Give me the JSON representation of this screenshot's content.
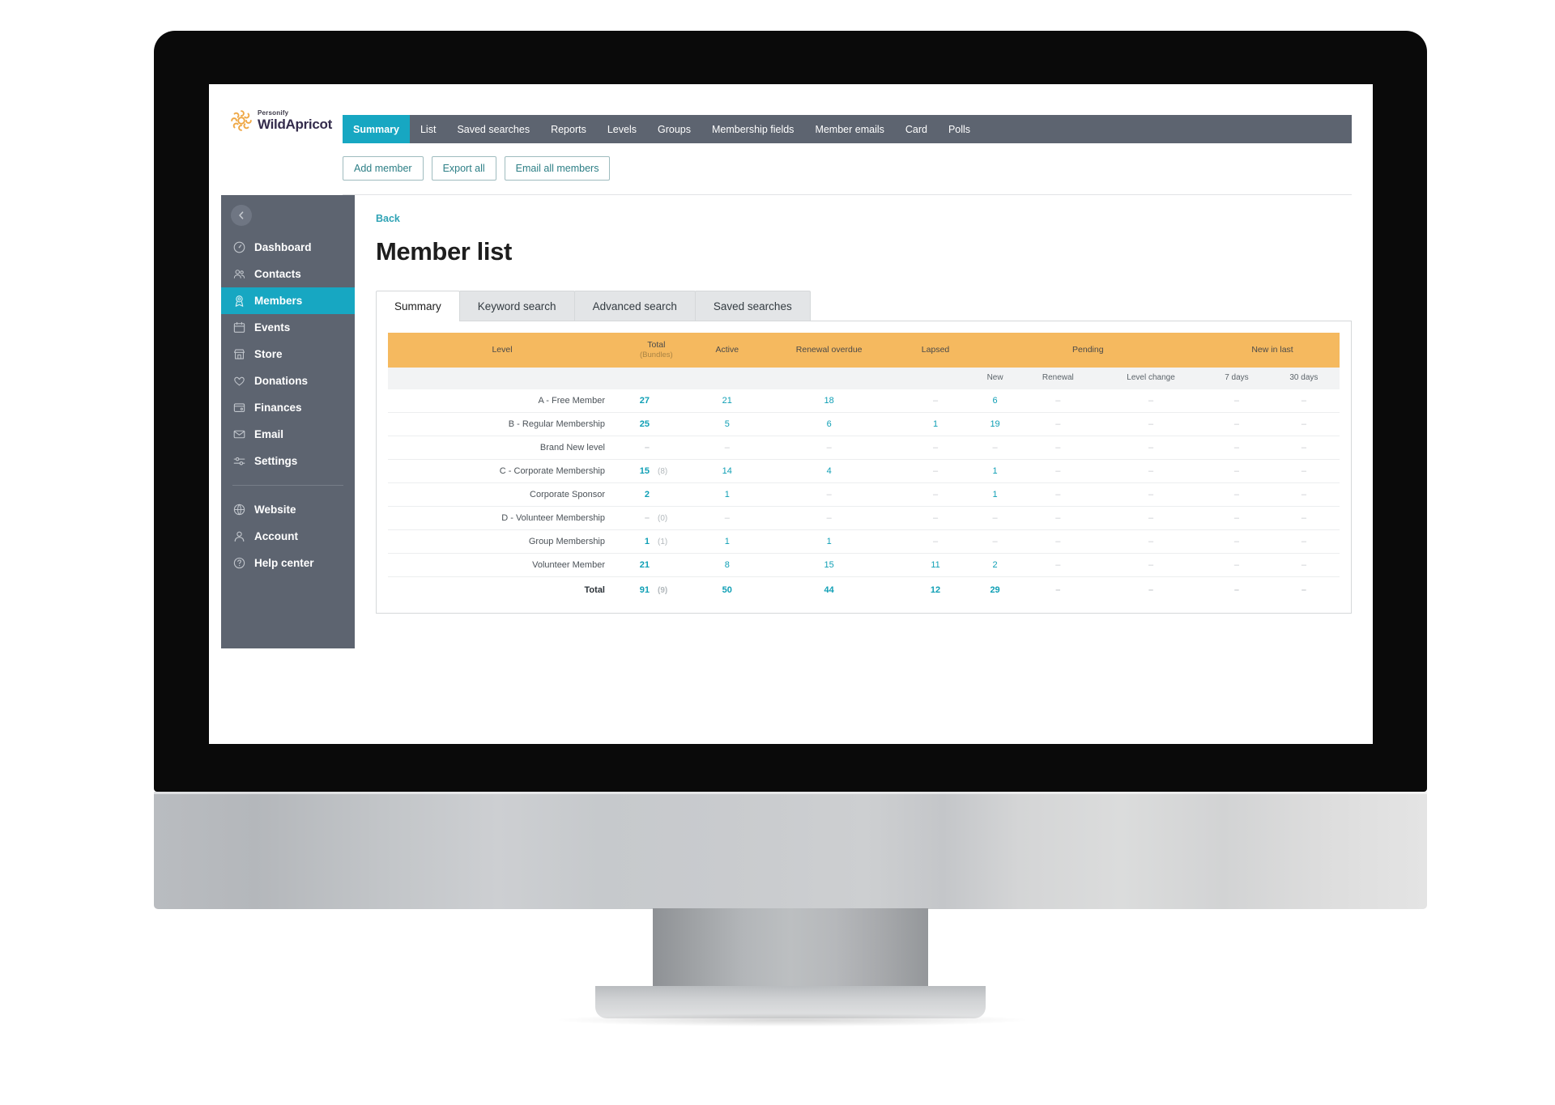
{
  "brand": {
    "parent": "Personify",
    "name": "WildApricot",
    "mark_icon": "sunburst-icon",
    "mark_color": "#efa846",
    "name_color": "#342c4c"
  },
  "top_nav": {
    "items": [
      {
        "label": "Summary",
        "active": true
      },
      {
        "label": "List",
        "active": false
      },
      {
        "label": "Saved searches",
        "active": false
      },
      {
        "label": "Reports",
        "active": false
      },
      {
        "label": "Levels",
        "active": false
      },
      {
        "label": "Groups",
        "active": false
      },
      {
        "label": "Membership fields",
        "active": false
      },
      {
        "label": "Member emails",
        "active": false
      },
      {
        "label": "Card",
        "active": false
      },
      {
        "label": "Polls",
        "active": false
      }
    ],
    "active_color": "#17a7c2",
    "bar_color": "#5d6470"
  },
  "action_bar": {
    "buttons": [
      {
        "label": "Add member",
        "name": "add-member-button"
      },
      {
        "label": "Export all",
        "name": "export-all-button"
      },
      {
        "label": "Email all members",
        "name": "email-all-members-button"
      }
    ]
  },
  "sidebar": {
    "collapse_icon": "chevron-left-icon",
    "items": [
      {
        "label": "Dashboard",
        "icon": "speedometer-icon",
        "active": false
      },
      {
        "label": "Contacts",
        "icon": "people-icon",
        "active": false
      },
      {
        "label": "Members",
        "icon": "member-badge-icon",
        "active": true
      },
      {
        "label": "Events",
        "icon": "calendar-icon",
        "active": false
      },
      {
        "label": "Store",
        "icon": "storefront-icon",
        "active": false
      },
      {
        "label": "Donations",
        "icon": "heart-icon",
        "active": false
      },
      {
        "label": "Finances",
        "icon": "wallet-icon",
        "active": false
      },
      {
        "label": "Email",
        "icon": "envelope-icon",
        "active": false
      },
      {
        "label": "Settings",
        "icon": "sliders-icon",
        "active": false
      }
    ],
    "items_secondary": [
      {
        "label": "Website",
        "icon": "globe-icon",
        "active": false
      },
      {
        "label": "Account",
        "icon": "person-icon",
        "active": false
      },
      {
        "label": "Help center",
        "icon": "question-circle-icon",
        "active": false
      }
    ]
  },
  "main": {
    "back_label": "Back",
    "title": "Member list",
    "tabs": [
      {
        "label": "Summary",
        "active": true
      },
      {
        "label": "Keyword search",
        "active": false
      },
      {
        "label": "Advanced search",
        "active": false
      },
      {
        "label": "Saved searches",
        "active": false
      }
    ]
  },
  "chart_data": {
    "type": "table",
    "title": "Member list summary",
    "header_color": "#f5b95f",
    "group_headers": [
      {
        "label": "Level",
        "sub": ""
      },
      {
        "label": "Total",
        "sub": "(Bundles)"
      },
      {
        "label": "Active",
        "sub": ""
      },
      {
        "label": "Renewal overdue",
        "sub": ""
      },
      {
        "label": "Lapsed",
        "sub": ""
      },
      {
        "label": "Pending",
        "sub": "",
        "span": 3
      },
      {
        "label": "New in last",
        "sub": "",
        "span": 2
      }
    ],
    "sub_headers": [
      "",
      "",
      "",
      "",
      "",
      "New",
      "Renewal",
      "Level change",
      "7 days",
      "30 days"
    ],
    "columns": [
      "Level",
      "Total",
      "Bundles",
      "Active",
      "Renewal overdue",
      "Lapsed",
      "Pending New",
      "Pending Renewal",
      "Pending Level change",
      "New in last 7 days",
      "New in last 30 days"
    ],
    "rows": [
      {
        "level": "A - Free Member",
        "total": "27",
        "bundles": "",
        "active": "21",
        "renewal_overdue": "18",
        "lapsed": "–",
        "pending_new": "6",
        "pending_renewal": "–",
        "pending_level_change": "–",
        "new_7": "–",
        "new_30": "–"
      },
      {
        "level": "B - Regular Membership",
        "total": "25",
        "bundles": "",
        "active": "5",
        "renewal_overdue": "6",
        "lapsed": "1",
        "pending_new": "19",
        "pending_renewal": "–",
        "pending_level_change": "–",
        "new_7": "–",
        "new_30": "–"
      },
      {
        "level": "Brand New level",
        "total": "–",
        "bundles": "",
        "active": "–",
        "renewal_overdue": "–",
        "lapsed": "–",
        "pending_new": "–",
        "pending_renewal": "–",
        "pending_level_change": "–",
        "new_7": "–",
        "new_30": "–"
      },
      {
        "level": "C - Corporate Membership",
        "total": "15",
        "bundles": "(8)",
        "active": "14",
        "renewal_overdue": "4",
        "lapsed": "–",
        "pending_new": "1",
        "pending_renewal": "–",
        "pending_level_change": "–",
        "new_7": "–",
        "new_30": "–"
      },
      {
        "level": "Corporate Sponsor",
        "total": "2",
        "bundles": "",
        "active": "1",
        "renewal_overdue": "–",
        "lapsed": "–",
        "pending_new": "1",
        "pending_renewal": "–",
        "pending_level_change": "–",
        "new_7": "–",
        "new_30": "–"
      },
      {
        "level": "D - Volunteer Membership",
        "total": "–",
        "bundles": "(0)",
        "active": "–",
        "renewal_overdue": "–",
        "lapsed": "–",
        "pending_new": "–",
        "pending_renewal": "–",
        "pending_level_change": "–",
        "new_7": "–",
        "new_30": "–"
      },
      {
        "level": "Group Membership",
        "total": "1",
        "bundles": "(1)",
        "active": "1",
        "renewal_overdue": "1",
        "lapsed": "–",
        "pending_new": "–",
        "pending_renewal": "–",
        "pending_level_change": "–",
        "new_7": "–",
        "new_30": "–"
      },
      {
        "level": "Volunteer Member",
        "total": "21",
        "bundles": "",
        "active": "8",
        "renewal_overdue": "15",
        "lapsed": "11",
        "pending_new": "2",
        "pending_renewal": "–",
        "pending_level_change": "–",
        "new_7": "–",
        "new_30": "–"
      }
    ],
    "total_row": {
      "level": "Total",
      "total": "91",
      "bundles": "(9)",
      "active": "50",
      "renewal_overdue": "44",
      "lapsed": "12",
      "pending_new": "29",
      "pending_renewal": "–",
      "pending_level_change": "–",
      "new_7": "–",
      "new_30": "–"
    }
  }
}
